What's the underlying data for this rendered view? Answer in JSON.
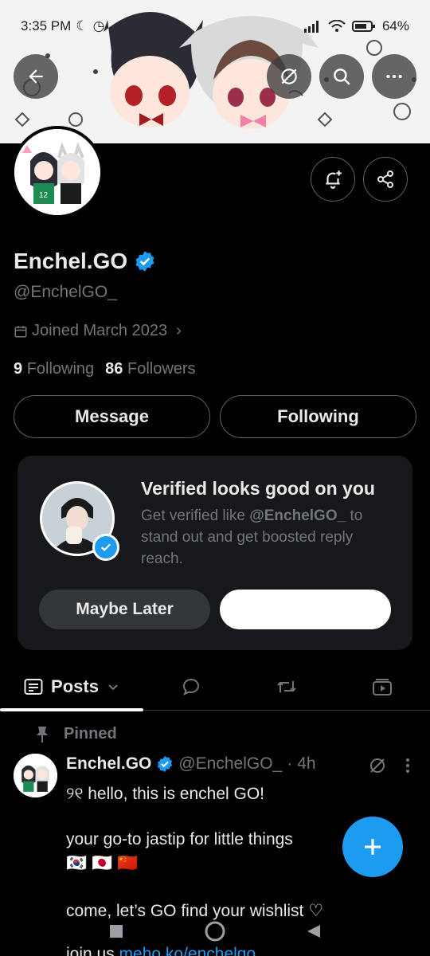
{
  "status_bar": {
    "time": "3:35 PM",
    "battery": "64%"
  },
  "profile": {
    "display_name": "Enchel.GO",
    "handle": "@EnchelGO_",
    "joined": "Joined March 2023",
    "following_count": "9",
    "following_label": "Following",
    "followers_count": "86",
    "followers_label": "Followers"
  },
  "actions": {
    "message_label": "Message",
    "following_label": "Following"
  },
  "verified_card": {
    "title": "Verified looks good on you",
    "body_prefix": "Get verified like ",
    "body_handle": "@EnchelGO_",
    "body_suffix": " to stand out and get boosted reply reach.",
    "maybe_later_label": "Maybe Later"
  },
  "tabs": {
    "posts_label": "Posts"
  },
  "pinned_post": {
    "pinned_label": "Pinned",
    "author_name": "Enchel.GO",
    "author_handle": "@EnchelGO_",
    "separator": "·",
    "time": "4h",
    "line1": "୨୧ hello, this is enchel GO!",
    "line2": "your go-to jastip for little things",
    "flags": "🇰🇷 🇯🇵 🇨🇳",
    "line3": "come, let’s GO find your wishlist ♡",
    "line4_prefix": "join us",
    "line4_link": "meho.ko/enchelgo"
  },
  "colors": {
    "accent": "#1d9bf0",
    "background": "#000000",
    "secondary_text": "#71767b",
    "card_bg": "#16181c",
    "border": "#536471"
  },
  "icons": [
    "back-arrow-icon",
    "hide-icon",
    "search-icon",
    "more-icon",
    "notification-plus-icon",
    "share-icon",
    "verified-badge-icon",
    "calendar-icon",
    "chevron-right-icon",
    "posts-icon",
    "chevron-down-icon",
    "replies-icon",
    "reposts-icon",
    "media-icon",
    "pin-icon",
    "plus-icon"
  ]
}
